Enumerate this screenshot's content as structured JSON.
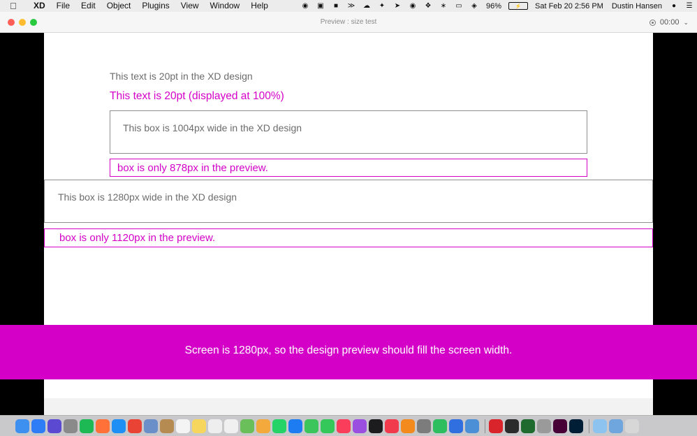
{
  "menubar": {
    "app_name": "XD",
    "items": [
      "File",
      "Edit",
      "Object",
      "Plugins",
      "View",
      "Window",
      "Help"
    ],
    "battery_percent": "96%",
    "datetime": "Sat Feb 20  2:56 PM",
    "user": "Dustin Hansen"
  },
  "window": {
    "title": "Preview : size test",
    "timer": "00:00"
  },
  "artboard": {
    "text_20pt_design": "This text is 20pt in the XD design",
    "text_20pt_displayed": "This text is 20pt (displayed at 100%)",
    "box_1004_label": "This box is 1004px wide in the XD design",
    "box_878_label": "box is only 878px in the preview.",
    "box_1280_label": "This box is 1280px wide in the XD design",
    "box_1120_label": "box is only 1120px in the preview.",
    "banner": "Screen is 1280px, so the design preview should fill the screen width."
  },
  "colors": {
    "accent_magenta": "#d400c8",
    "gray_text": "#6c6c6c"
  },
  "dock": {
    "apps": [
      {
        "name": "finder-icon",
        "color": "#3d8ff0"
      },
      {
        "name": "app-store-icon",
        "color": "#2f7df6"
      },
      {
        "name": "siri-icon",
        "color": "#5b4ad1"
      },
      {
        "name": "launchpad-icon",
        "color": "#8a8a8a"
      },
      {
        "name": "spotify-icon",
        "color": "#1db954"
      },
      {
        "name": "firefox-icon",
        "color": "#ff7139"
      },
      {
        "name": "safari-icon",
        "color": "#1e8ff5"
      },
      {
        "name": "chrome-icon",
        "color": "#e94335"
      },
      {
        "name": "preview-icon",
        "color": "#6b8fc9"
      },
      {
        "name": "notes-brown-icon",
        "color": "#b68b52"
      },
      {
        "name": "calendar-icon",
        "color": "#f4f4f4"
      },
      {
        "name": "notes-icon",
        "color": "#f6d65c"
      },
      {
        "name": "textedit-icon",
        "color": "#eeeeee"
      },
      {
        "name": "reminders-icon",
        "color": "#f0f0f0"
      },
      {
        "name": "maps-icon",
        "color": "#6bbf5a"
      },
      {
        "name": "photos-icon",
        "color": "#f3a93c"
      },
      {
        "name": "whatsapp-icon",
        "color": "#25d366"
      },
      {
        "name": "messenger-icon",
        "color": "#1e7cf2"
      },
      {
        "name": "messages-icon",
        "color": "#3bc55b"
      },
      {
        "name": "facetime-icon",
        "color": "#34c759"
      },
      {
        "name": "music-icon",
        "color": "#fa3d5a"
      },
      {
        "name": "podcasts-icon",
        "color": "#9b4fe0"
      },
      {
        "name": "apple-tv-icon",
        "color": "#1c1c1e"
      },
      {
        "name": "news-icon",
        "color": "#f23a4d"
      },
      {
        "name": "books-icon",
        "color": "#f28a1d"
      },
      {
        "name": "system-prefs-icon",
        "color": "#7c7c7c"
      },
      {
        "name": "evernote-icon",
        "color": "#2dbe60"
      },
      {
        "name": "1password-icon",
        "color": "#2f6fe0"
      },
      {
        "name": "image-capture-icon",
        "color": "#4b8fd6"
      },
      {
        "name": "bbedit-icon",
        "color": "#d9242b"
      },
      {
        "name": "activity-monitor-icon",
        "color": "#2b2b2b"
      },
      {
        "name": "terminal-icon",
        "color": "#1f6b2f"
      },
      {
        "name": "disk-utility-icon",
        "color": "#9a9a9a"
      },
      {
        "name": "adobe-xd-icon",
        "color": "#470137"
      },
      {
        "name": "photoshop-icon",
        "color": "#001e36"
      },
      {
        "name": "folder-icon",
        "color": "#8cc3ef"
      },
      {
        "name": "downloads-icon",
        "color": "#6fa6dd"
      },
      {
        "name": "trash-icon",
        "color": "#d7d7d7"
      }
    ]
  }
}
